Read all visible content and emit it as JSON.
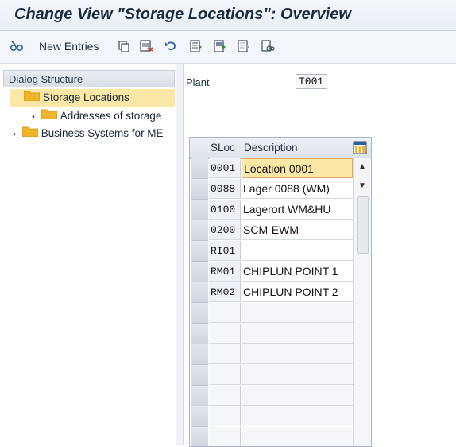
{
  "window": {
    "title": "Change View \"Storage Locations\": Overview"
  },
  "toolbar": {
    "new_entries_label": "New Entries",
    "icons": [
      "glasses-edit-icon",
      "copy-icon",
      "delete-icon",
      "undo-icon",
      "select-all-icon",
      "select-block-icon",
      "deselect-all-icon",
      "print-icon"
    ]
  },
  "dialog_structure": {
    "header": "Dialog Structure",
    "items": [
      {
        "label": "Storage Locations",
        "selected": true,
        "level": 0,
        "expanded": true
      },
      {
        "label": "Addresses of storage",
        "selected": false,
        "level": 1
      },
      {
        "label": "Business Systems for ME",
        "selected": false,
        "level": 0
      }
    ]
  },
  "plant": {
    "label": "Plant",
    "value": "T001"
  },
  "table": {
    "columns": [
      "SLoc",
      "Description"
    ],
    "rows": [
      {
        "sloc": "0001",
        "description": "Location 0001"
      },
      {
        "sloc": "0088",
        "description": "Lager 0088 (WM)"
      },
      {
        "sloc": "0100",
        "description": "Lagerort WM&HU"
      },
      {
        "sloc": "0200",
        "description": "SCM-EWM"
      },
      {
        "sloc": "RI01",
        "description": ""
      },
      {
        "sloc": "RM01",
        "description": "CHIPLUN POINT 1"
      },
      {
        "sloc": "RM02",
        "description": "CHIPLUN POINT 2"
      }
    ]
  },
  "colors": {
    "selection": "#fbe8a6",
    "folder": "#f0b429",
    "title_text": "#1a2a3f"
  }
}
